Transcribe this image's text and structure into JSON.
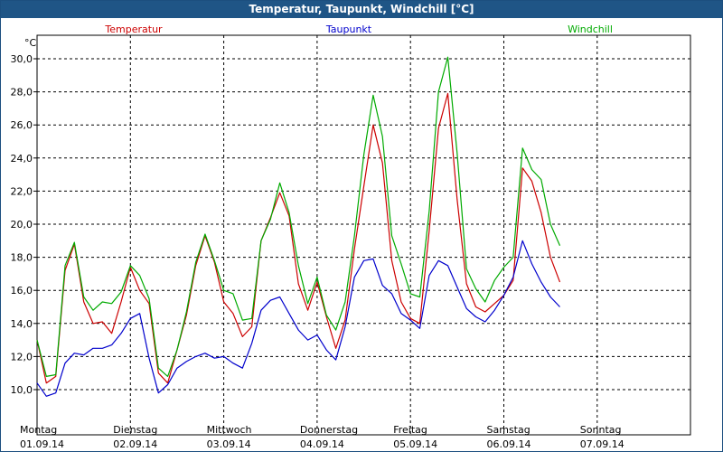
{
  "window": {
    "title": "Temperatur, Taupunkt, Windchill [°C]"
  },
  "chart_data": {
    "type": "line",
    "title": "Temperatur, Taupunkt, Windchill [°C]",
    "ylabel": "°C",
    "ylim": [
      9.0,
      31.5
    ],
    "grid": true,
    "legend_position": "top",
    "yticks": [
      "10,0",
      "12,0",
      "14,0",
      "16,0",
      "18,0",
      "20,0",
      "22,0",
      "24,0",
      "26,0",
      "28,0",
      "30,0"
    ],
    "x_day_labels": [
      {
        "day": "Montag",
        "date": "01.09.14"
      },
      {
        "day": "Dienstag",
        "date": "02.09.14"
      },
      {
        "day": "Mittwoch",
        "date": "03.09.14"
      },
      {
        "day": "Donnerstag",
        "date": "04.09.14"
      },
      {
        "day": "Freitag",
        "date": "05.09.14"
      },
      {
        "day": "Samstag",
        "date": "06.09.14"
      },
      {
        "day": "Sonntag",
        "date": "07.09.14"
      }
    ],
    "x_unit": "days since 01.09.14 00:00",
    "x": [
      0,
      0.1,
      0.2,
      0.3,
      0.4,
      0.5,
      0.6,
      0.7,
      0.8,
      0.9,
      1.0,
      1.1,
      1.2,
      1.3,
      1.4,
      1.5,
      1.6,
      1.7,
      1.8,
      1.9,
      2.0,
      2.1,
      2.2,
      2.3,
      2.4,
      2.5,
      2.6,
      2.7,
      2.8,
      2.9,
      3.0,
      3.1,
      3.2,
      3.3,
      3.4,
      3.5,
      3.6,
      3.7,
      3.8,
      3.9,
      4.0,
      4.1,
      4.2,
      4.3,
      4.4,
      4.5,
      4.6,
      4.7,
      4.8,
      4.9,
      5.0,
      5.1,
      5.2,
      5.3,
      5.4,
      5.5,
      5.6,
      5.7,
      5.8,
      5.9,
      6.0,
      6.1,
      6.2,
      6.3,
      6.4,
      6.5,
      6.6,
      6.7,
      6.8,
      6.9,
      7.0
    ],
    "series": [
      {
        "name": "Temperatur",
        "color": "#cc0000",
        "values": [
          13.0,
          10.4,
          10.8,
          17.2,
          18.8,
          15.3,
          14.0,
          14.1,
          13.4,
          15.3,
          17.4,
          16.0,
          15.2,
          11.0,
          10.4,
          12.4,
          14.5,
          17.5,
          19.3,
          17.7,
          15.3,
          14.6,
          13.2,
          13.8,
          19.0,
          20.4,
          21.9,
          20.5,
          16.4,
          14.8,
          16.5,
          14.4,
          12.5,
          14.2,
          18.5,
          22.3,
          26.0,
          23.7,
          17.8,
          15.3,
          14.3,
          14.0,
          19.6,
          25.8,
          27.9,
          21.5,
          16.4,
          15.0,
          14.7,
          15.2,
          15.7,
          16.6,
          23.4,
          22.6,
          20.7,
          18.0,
          16.5
        ]
      },
      {
        "name": "Taupunkt",
        "color": "#0000cc",
        "values": [
          10.4,
          9.6,
          9.8,
          11.6,
          12.2,
          12.1,
          12.5,
          12.5,
          12.7,
          13.4,
          14.3,
          14.6,
          11.9,
          9.8,
          10.3,
          11.3,
          11.7,
          12.0,
          12.2,
          11.9,
          12.0,
          11.6,
          11.3,
          12.8,
          14.8,
          15.4,
          15.6,
          14.6,
          13.6,
          13.0,
          13.3,
          12.4,
          11.8,
          13.8,
          16.8,
          17.8,
          17.9,
          16.3,
          15.8,
          14.6,
          14.2,
          13.7,
          16.9,
          17.8,
          17.5,
          16.2,
          14.9,
          14.4,
          14.1,
          14.8,
          15.7,
          16.8,
          19.0,
          17.6,
          16.5,
          15.6,
          15.0
        ]
      },
      {
        "name": "Windchill",
        "color": "#00aa00",
        "values": [
          13.0,
          10.8,
          10.9,
          17.5,
          18.9,
          15.6,
          14.8,
          15.3,
          15.2,
          15.9,
          17.5,
          16.9,
          15.5,
          11.3,
          10.8,
          12.4,
          14.7,
          17.7,
          19.4,
          17.8,
          16.0,
          15.8,
          14.2,
          14.3,
          19.0,
          20.3,
          22.5,
          20.7,
          17.5,
          15.2,
          16.8,
          14.5,
          13.6,
          15.3,
          19.3,
          24.2,
          27.8,
          25.3,
          19.3,
          17.6,
          15.8,
          15.6,
          20.8,
          28.0,
          30.1,
          24.3,
          17.3,
          16.1,
          15.3,
          16.6,
          17.4,
          18.0,
          24.6,
          23.3,
          22.7,
          20.0,
          18.7
        ]
      }
    ]
  }
}
